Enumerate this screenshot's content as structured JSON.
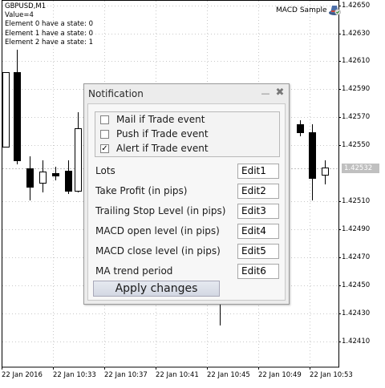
{
  "chart": {
    "symbol_timeframe": "GBPUSD,M1",
    "value_line": "Value=4",
    "element_states": [
      "Element 0 have a state: 0",
      "Element 1 have a state: 0",
      "Element 2 have a state: 1"
    ],
    "ea_name": "MACD Sample",
    "ea_icon": "expert-advisor-hat-icon",
    "current_price": "1.42532",
    "price_labels": [
      "1.42650",
      "1.42630",
      "1.42610",
      "1.42590",
      "1.42570",
      "1.42550",
      "1.42510",
      "1.42490",
      "1.42470",
      "1.42450",
      "1.42430",
      "1.42410"
    ],
    "time_labels": [
      "22 Jan 2016",
      "22 Jan 10:33",
      "22 Jan 10:37",
      "22 Jan 10:41",
      "22 Jan 10:45",
      "22 Jan 10:49",
      "22 Jan 10:53"
    ]
  },
  "dialog": {
    "title": "Notification",
    "checkboxes": [
      {
        "label": "Mail if Trade event",
        "checked": false
      },
      {
        "label": "Push if Trade event",
        "checked": false
      },
      {
        "label": "Alert if Trade event",
        "checked": true
      }
    ],
    "params": [
      {
        "label": "Lots",
        "value": "Edit1"
      },
      {
        "label": "Take Profit (in pips)",
        "value": "Edit2"
      },
      {
        "label": "Trailing Stop Level (in pips)",
        "value": "Edit3"
      },
      {
        "label": "MACD open level (in pips)",
        "value": "Edit4"
      },
      {
        "label": "MACD close level (in pips)",
        "value": "Edit5"
      },
      {
        "label": "MA trend period",
        "value": "Edit6"
      }
    ],
    "apply_label": "Apply changes"
  }
}
